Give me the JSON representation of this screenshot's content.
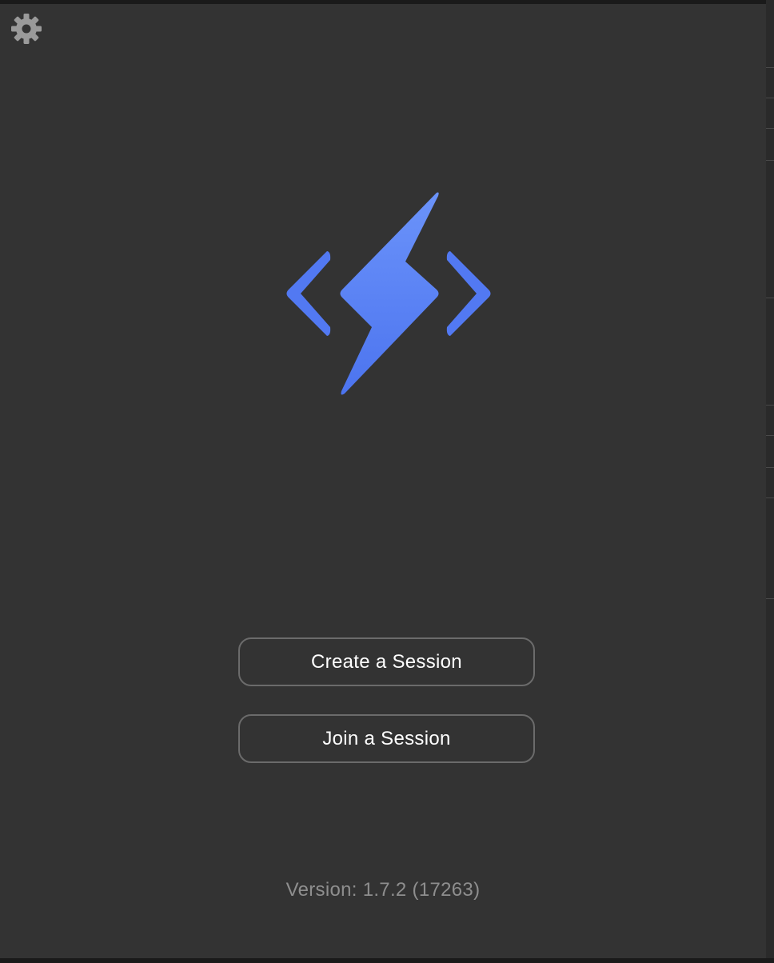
{
  "app": {
    "settings_icon": "gear-icon",
    "logo_icon": "lightning-code-brackets-icon",
    "accent_color": "#5b86f5"
  },
  "actions": {
    "create_label": "Create a Session",
    "join_label": "Join a Session"
  },
  "footer": {
    "version_text": "Version: 1.7.2 (17263)"
  }
}
